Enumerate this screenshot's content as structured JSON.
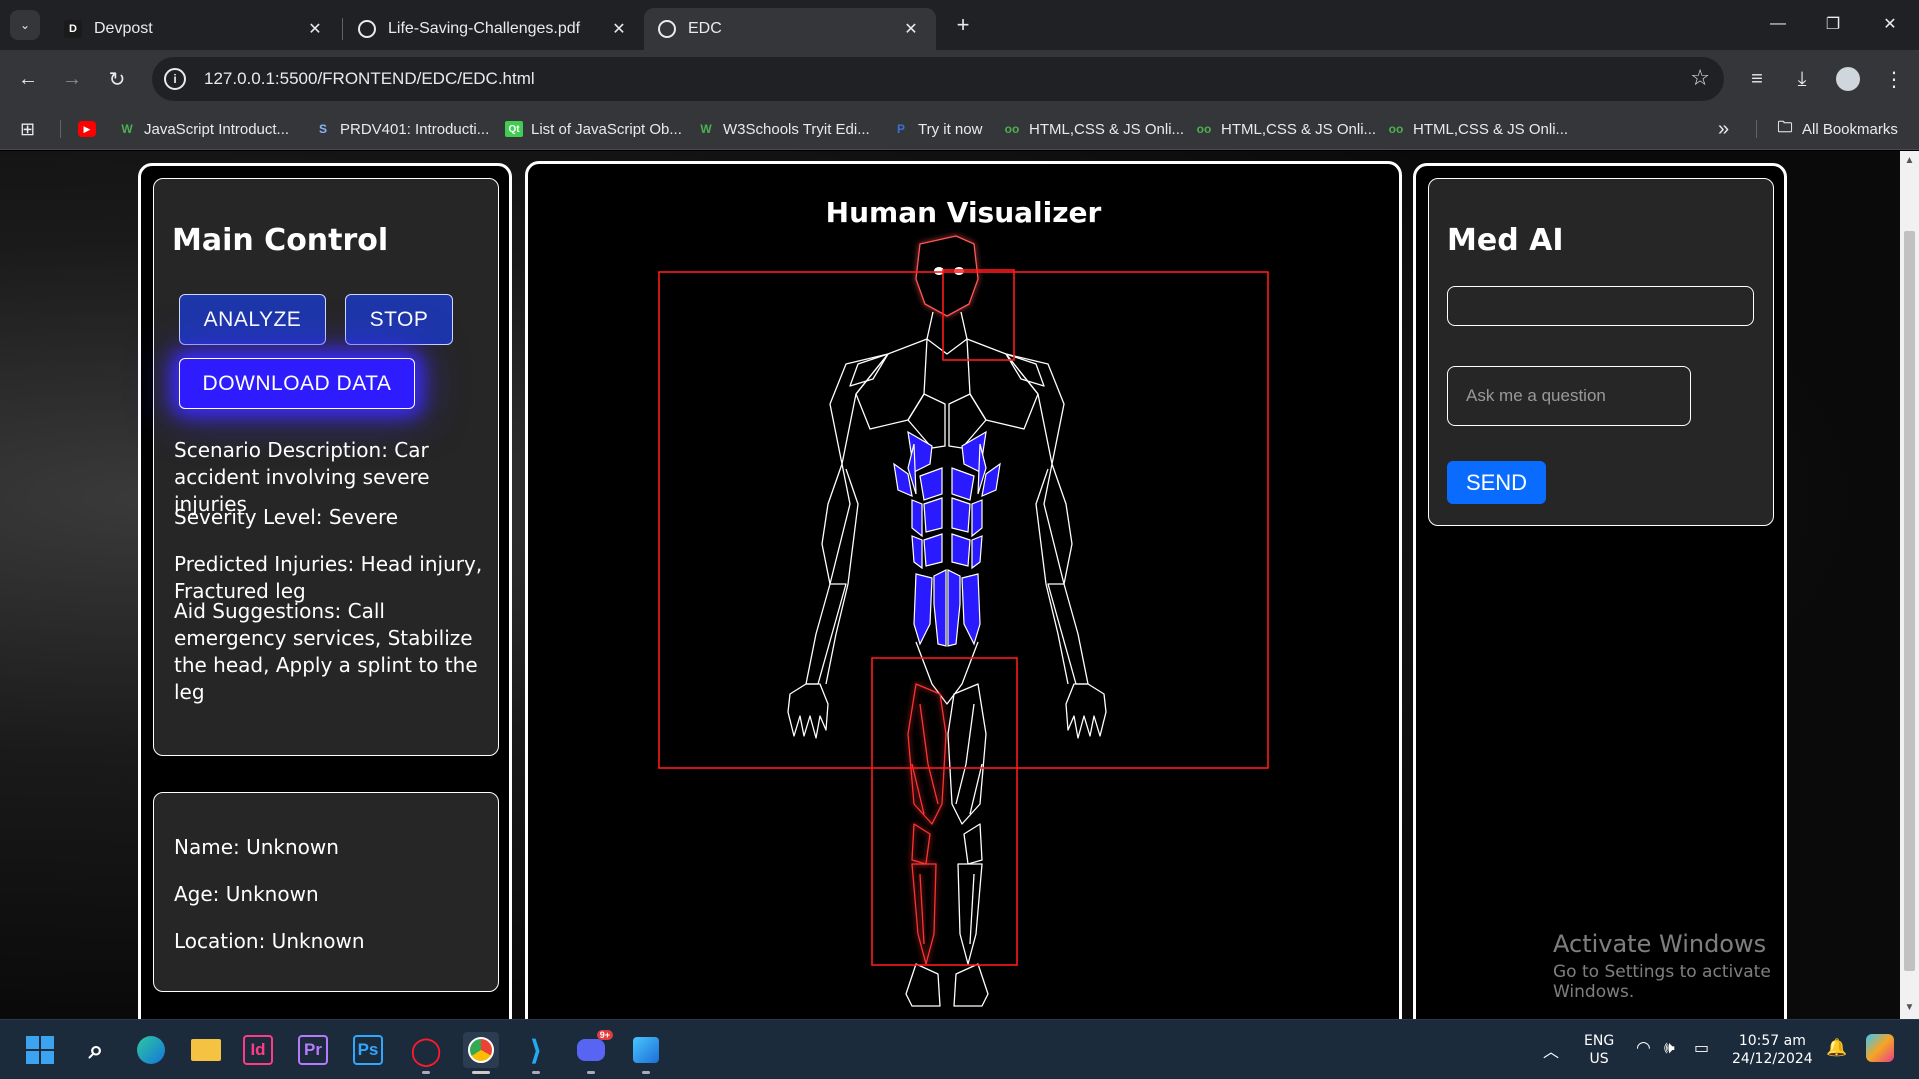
{
  "browser": {
    "tabs": [
      {
        "title": "Devpost",
        "favicon": "D"
      },
      {
        "title": "Life-Saving-Challenges.pdf",
        "favicon": "globe"
      },
      {
        "title": "EDC",
        "favicon": "globe"
      }
    ],
    "active_tab": 2,
    "url": "127.0.0.1:5500/FRONTEND/EDC/EDC.html",
    "bookmarks": [
      {
        "label": "",
        "icon": "youtube"
      },
      {
        "label": "JavaScript Introduct...",
        "icon": "W"
      },
      {
        "label": "PRDV401: Introducti...",
        "icon": "S"
      },
      {
        "label": "List of JavaScript Ob...",
        "icon": "Qt"
      },
      {
        "label": "W3Schools Tryit Edi...",
        "icon": "W"
      },
      {
        "label": "Try it now",
        "icon": "P"
      },
      {
        "label": "HTML,CSS & JS Onli...",
        "icon": "oo"
      },
      {
        "label": "HTML,CSS & JS Onli...",
        "icon": "oo"
      },
      {
        "label": "HTML,CSS & JS Onli...",
        "icon": "oo"
      }
    ],
    "more_bookmarks": "»",
    "all_bookmarks": "All Bookmarks"
  },
  "main_control": {
    "heading": "Main Control",
    "analyze_label": "ANALYZE",
    "stop_label": "STOP",
    "download_label": "DOWNLOAD DATA",
    "scenario": "Scenario Description: Car accident involving severe injuries",
    "severity": "Severity Level: Severe",
    "injuries": "Predicted Injuries: Head injury, Fractured leg",
    "aid": "Aid Suggestions: Call emergency services, Stabilize the head, Apply a splint to the leg"
  },
  "patient": {
    "name": "Name: Unknown",
    "age": "Age: Unknown",
    "location": "Location: Unknown"
  },
  "visualizer": {
    "heading": "Human Visualizer",
    "highlight_color": "#ff1a1a",
    "torso_color": "#2a1aff"
  },
  "med_ai": {
    "heading": "Med AI",
    "response_value": "",
    "question_placeholder": "Ask me a question",
    "send_label": "SEND"
  },
  "watermark": {
    "title": "Activate Windows",
    "subtitle": "Go to Settings to activate Windows."
  },
  "taskbar": {
    "lang_top": "ENG",
    "lang_bottom": "US",
    "time": "10:57 am",
    "date": "24/12/2024",
    "discord_badge": "9+"
  }
}
